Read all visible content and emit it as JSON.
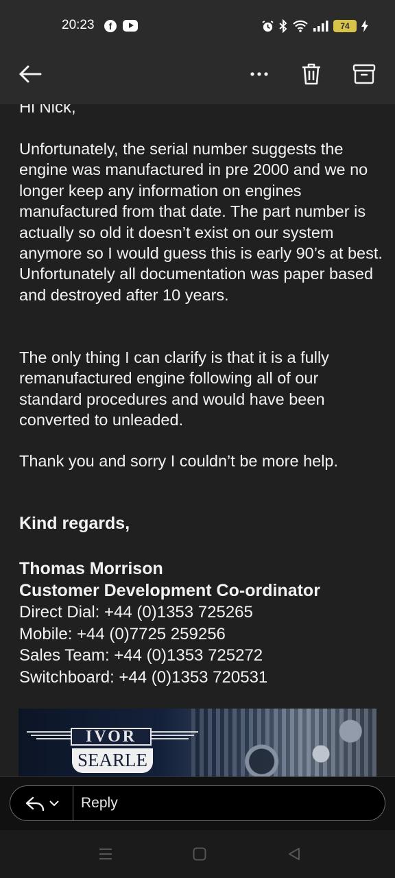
{
  "status_bar": {
    "time": "20:23",
    "battery_level": "74",
    "icons": [
      "facebook-icon",
      "youtube-icon",
      "alarm-icon",
      "bluetooth-icon",
      "wifi-icon",
      "signal-icon",
      "battery-icon",
      "charging-icon"
    ]
  },
  "app_bar": {
    "icons": [
      "back-arrow-icon",
      "more-icon",
      "delete-icon",
      "archive-icon"
    ]
  },
  "email": {
    "greeting": "Hi Nick,",
    "paragraphs": [
      "Unfortunately, the serial number suggests the engine was manufactured in pre 2000 and we no longer keep any information on engines manufactured from that date. The part number is actually so old it doesn’t exist on our system anymore so I would guess this is early 90’s at best. Unfortunately all documentation was paper based and destroyed after 10 years.",
      "The only thing I can clarify is that it is a fully remanufactured engine following all of our standard procedures and would have been converted to unleaded.",
      "Thank you and sorry I couldn’t be more help."
    ],
    "sign_off": "Kind regards,",
    "signature": {
      "name": "Thomas Morrison",
      "title": "Customer Development Co-ordinator",
      "direct_dial": "Direct Dial: +44 (0)1353 725265",
      "mobile": "Mobile: +44 (0)7725 259256",
      "sales_team": "Sales Team: +44 (0)1353 725272",
      "switchboard": "Switchboard: +44 (0)1353 720531"
    },
    "banner": {
      "logo_line1": "IVOR",
      "logo_line2": "SEARLE"
    }
  },
  "reply_bar": {
    "placeholder": "Reply"
  },
  "colors": {
    "background": "#202020",
    "bars": "#2b2b2b",
    "text": "#f2f2f2",
    "battery": "#d8c34a"
  }
}
